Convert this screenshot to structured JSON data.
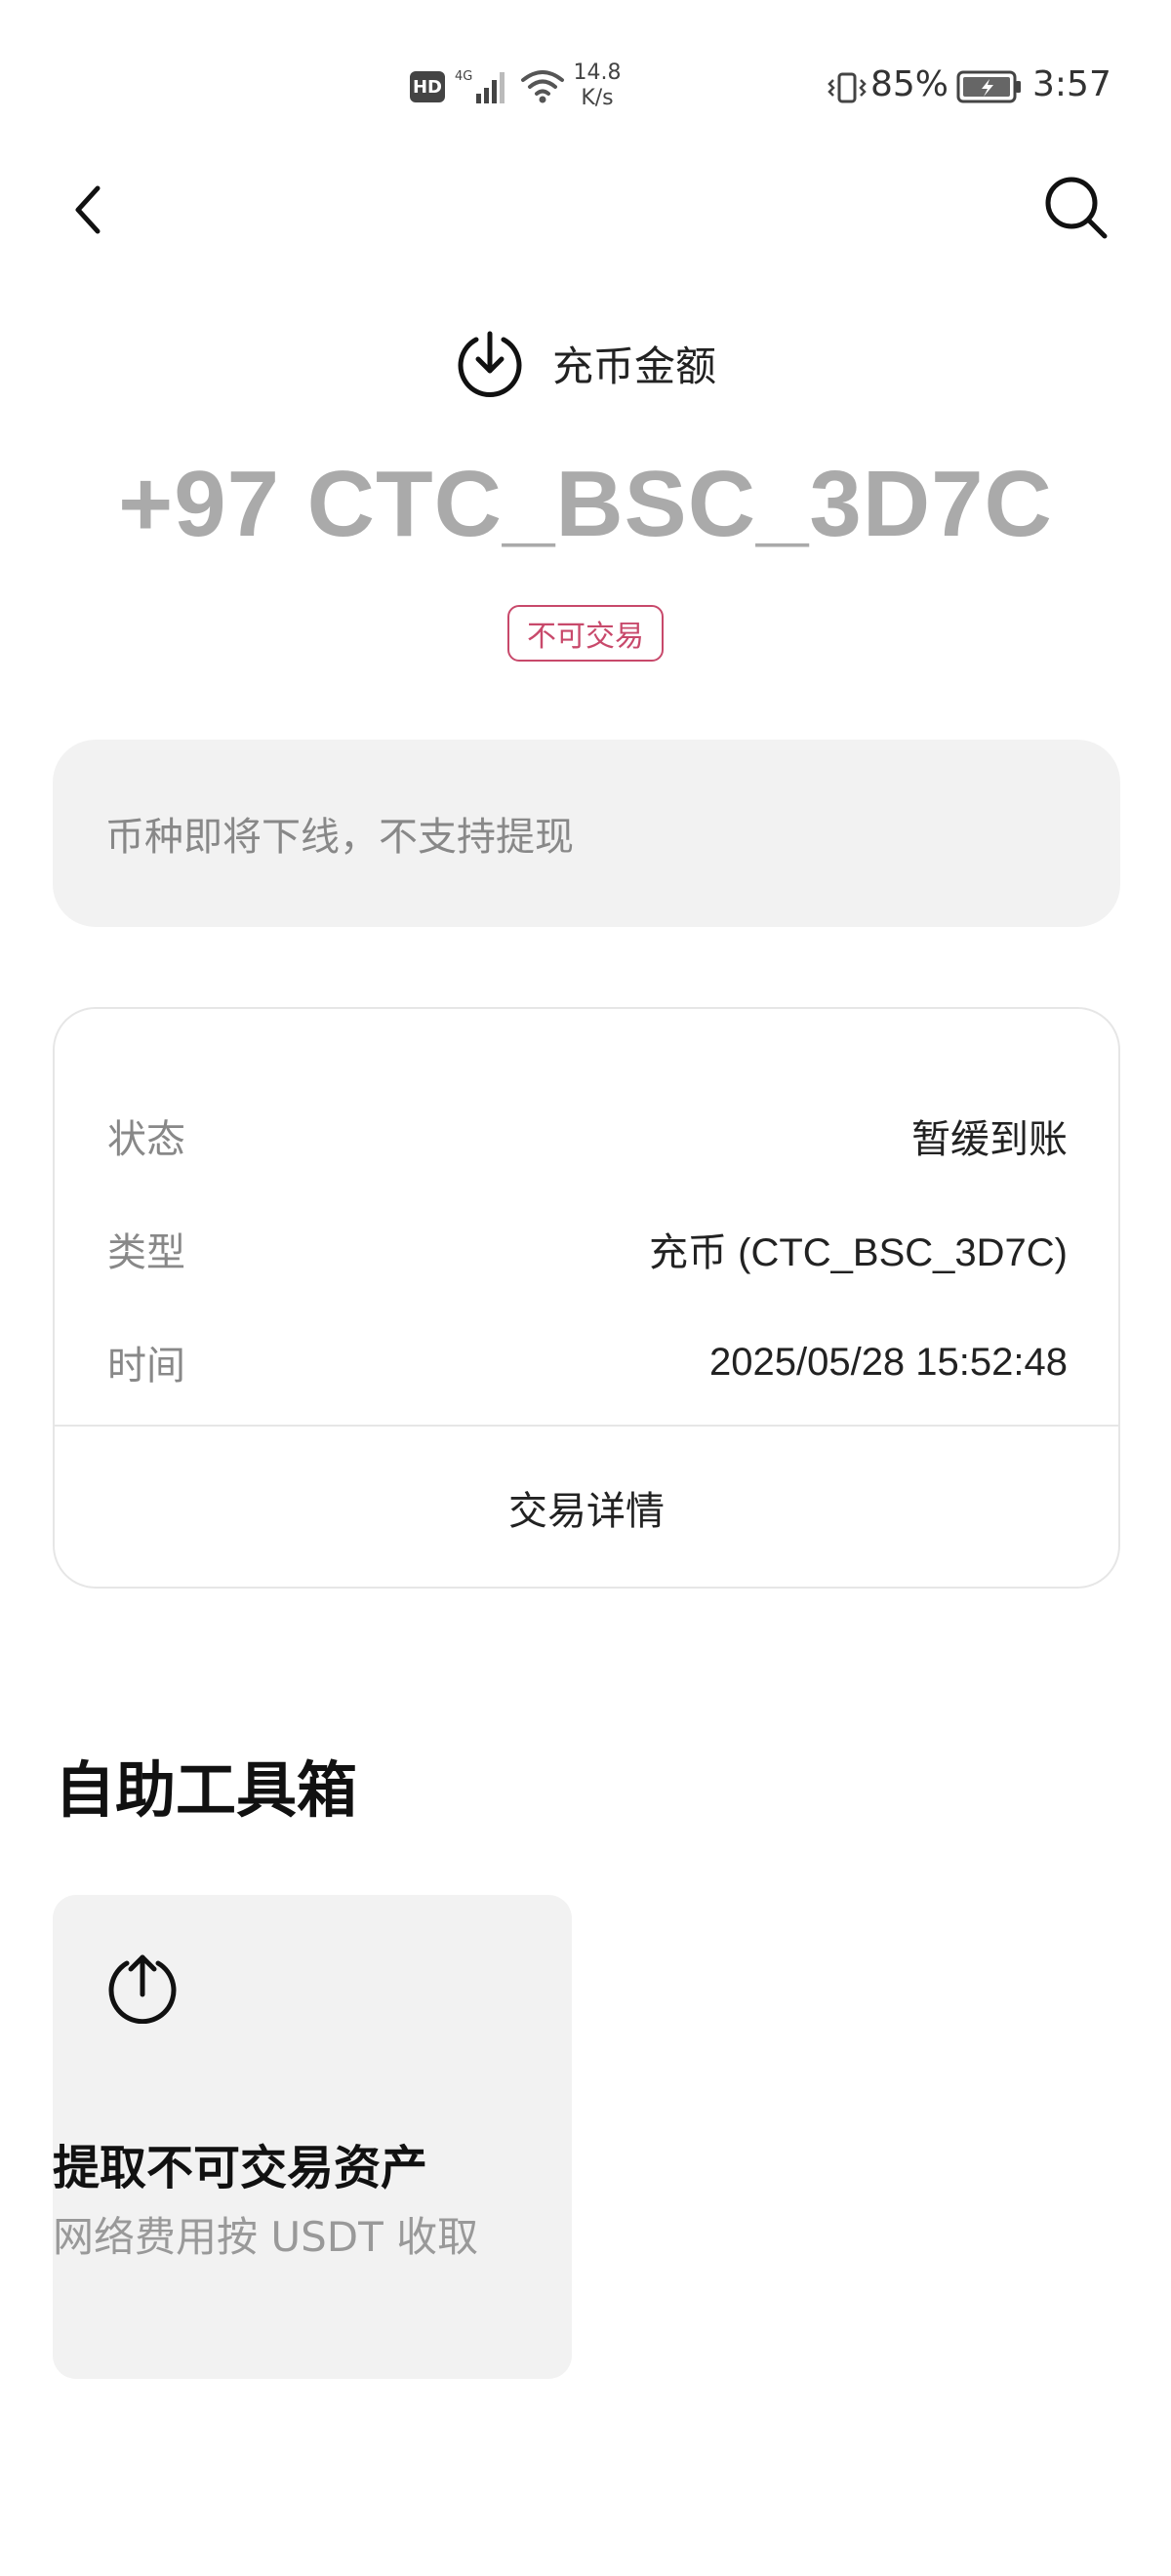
{
  "status_bar": {
    "hd": "HD",
    "network": "4G",
    "net_speed_value": "14.8",
    "net_speed_unit": "K/s",
    "battery": "85%",
    "time": "3:57"
  },
  "header": {
    "back_icon": "chevron-left-icon",
    "search_icon": "search-icon"
  },
  "deposit": {
    "title": "充币金额",
    "icon": "download-circle-icon",
    "amount": "+97 CTC_BSC_3D7C",
    "tag": "不可交易"
  },
  "notice": {
    "text": "币种即将下线，不支持提现"
  },
  "info": {
    "rows": [
      {
        "label": "状态",
        "value": "暂缓到账"
      },
      {
        "label": "类型",
        "value": "充币 (CTC_BSC_3D7C)"
      },
      {
        "label": "时间",
        "value": "2025/05/28 15:52:48"
      }
    ],
    "detail_link": "交易详情"
  },
  "toolbox": {
    "title": "自助工具箱",
    "tool": {
      "icon": "upload-circle-icon",
      "title": "提取不可交易资产",
      "desc": "网络费用按 USDT 收取"
    }
  },
  "colors": {
    "tag": "#c8496b",
    "amount": "#aaaaaa",
    "panel": "#f2f2f2"
  }
}
